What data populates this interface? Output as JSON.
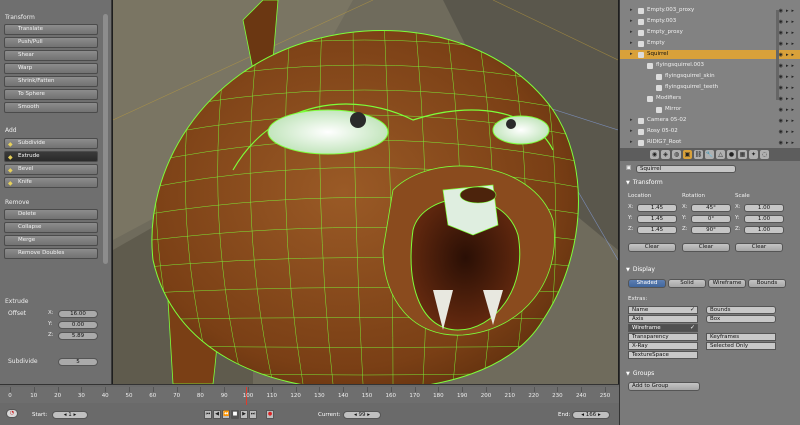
{
  "left_panel": {
    "transform_label": "Transform",
    "transform_tools": [
      "Translate",
      "Push/Pull",
      "Shear",
      "Warp",
      "Shrink/Fatten",
      "To Sphere",
      "Smooth"
    ],
    "add_label": "Add",
    "add_tools": [
      "Subdivide",
      "Extrude",
      "Bevel",
      "Knife"
    ],
    "active_tool": "Extrude",
    "remove_label": "Remove",
    "remove_tools": [
      "Delete",
      "Collapse",
      "Merge",
      "Remove Doubles"
    ],
    "extrude_label": "Extrude",
    "offset_label": "Offset",
    "offset": {
      "x": "16.00",
      "y": "0.00",
      "z": "5.89"
    },
    "axis_x": "X:",
    "axis_y": "Y:",
    "axis_z": "Z:",
    "subdivide_label": "Subdivide",
    "subdivide_value": "5"
  },
  "outliner": {
    "rows": [
      {
        "label": "Empty.003_proxy",
        "indent": 0,
        "selected": false
      },
      {
        "label": "Empty.003",
        "indent": 0,
        "selected": false
      },
      {
        "label": "Empty_proxy",
        "indent": 0,
        "selected": false
      },
      {
        "label": "Empty",
        "indent": 0,
        "selected": false
      },
      {
        "label": "Squirrel",
        "indent": 0,
        "selected": true
      },
      {
        "label": "flyingsquirrel.003",
        "indent": 1,
        "selected": false
      },
      {
        "label": "flyingsquirrel_skin",
        "indent": 2,
        "selected": false
      },
      {
        "label": "flyingsquirrel_teeth",
        "indent": 2,
        "selected": false
      },
      {
        "label": "Modifiers",
        "indent": 1,
        "selected": false
      },
      {
        "label": "Mirror",
        "indent": 2,
        "selected": false
      },
      {
        "label": "Camera 05-02",
        "indent": 0,
        "selected": false
      },
      {
        "label": "Rosy 05-02",
        "indent": 0,
        "selected": false
      },
      {
        "label": "RIDIG7_Root",
        "indent": 0,
        "selected": false
      }
    ]
  },
  "properties": {
    "object_name": "Squirrel",
    "transform_label": "Transform",
    "location_label": "Location",
    "rotation_label": "Rotation",
    "scale_label": "Scale",
    "location": [
      "1.45",
      "1.45",
      "1.45"
    ],
    "rotation": [
      "45°",
      "0°",
      "90°"
    ],
    "scale": [
      "1.00",
      "1.00",
      "1.00"
    ],
    "axes": [
      "X:",
      "Y:",
      "Z:"
    ],
    "clear_label": "Clear",
    "display_label": "Display",
    "display_modes": [
      "Shaded",
      "Solid",
      "Wireframe",
      "Bounds"
    ],
    "active_display_mode": "Shaded",
    "extras_label": "Extras:",
    "extras_left": [
      {
        "label": "Name",
        "on": false,
        "checked": true
      },
      {
        "label": "Axis",
        "on": false,
        "checked": false
      },
      {
        "label": "Wireframe",
        "on": true,
        "checked": true
      },
      {
        "label": "Transparency",
        "on": false,
        "checked": false
      },
      {
        "label": "X-Ray",
        "on": false,
        "checked": false
      },
      {
        "label": "TextureSpace",
        "on": false,
        "checked": false
      }
    ],
    "extras_right_top": [
      {
        "label": "Bounds"
      },
      {
        "label": "Box"
      }
    ],
    "extras_right_bottom": [
      {
        "label": "Keyframes"
      },
      {
        "label": "Selected Only"
      }
    ],
    "groups_label": "Groups",
    "add_to_group": "Add to Group"
  },
  "timeline": {
    "ticks": [
      "0",
      "10",
      "20",
      "30",
      "40",
      "50",
      "60",
      "70",
      "80",
      "90",
      "100",
      "110",
      "120",
      "130",
      "140",
      "150",
      "160",
      "170",
      "180",
      "190",
      "200",
      "210",
      "220",
      "230",
      "240",
      "250"
    ],
    "start_label": "Start:",
    "start_value": "1",
    "current_label": "Current:",
    "current_value": "99",
    "end_label": "End:",
    "end_value": "166",
    "current_frame": 99
  },
  "colors": {
    "wireframe": "#7dff3a",
    "model": "#8a4a1c",
    "selection": "#d9a13a",
    "active_blue": "#4a6fa5"
  }
}
